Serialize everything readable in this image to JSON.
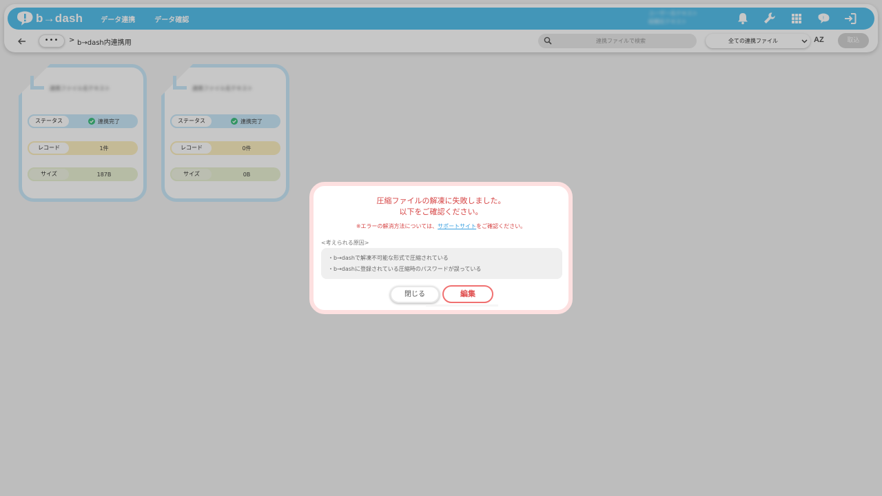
{
  "brand": {
    "name": "b→dash",
    "accent_color": "#56c0ec"
  },
  "nav": {
    "links": [
      "データ連携",
      "データ確認"
    ],
    "user_info_blurred": [
      "ユーザー名テキスト",
      "組織名テキスト"
    ],
    "icons": [
      "bell-icon",
      "wrench-icon",
      "apps-grid-icon",
      "help-chat-icon",
      "logout-icon"
    ]
  },
  "subbar": {
    "dots": "•••",
    "breadcrumb_sep": ">",
    "breadcrumb_current": "b→dash内連携用",
    "search_placeholder": "連携ファイルで検索",
    "filter_selected": "全ての連携ファイル",
    "sort_label": "AZ",
    "fetch_label": "取込"
  },
  "cards": [
    {
      "title_blurred": "連携ファイル名テキスト",
      "status_label": "ステータス",
      "status_value": "連携完了",
      "record_label": "レコード",
      "record_value": "1件",
      "size_label": "サイズ",
      "size_value": "187B"
    },
    {
      "title_blurred": "連携ファイル名テキスト",
      "status_label": "ステータス",
      "status_value": "連携完了",
      "record_label": "レコード",
      "record_value": "0件",
      "size_label": "サイズ",
      "size_value": "0B"
    }
  ],
  "modal": {
    "title_line1": "圧縮ファイルの解凍に失敗しました。",
    "title_line2": "以下をご確認ください。",
    "note_prefix": "※エラーの解消方法については、",
    "note_link": "サポートサイト",
    "note_suffix": "をご確認ください。",
    "causes_heading": "<考えられる原因>",
    "causes": [
      "・b→dashで解凍不可能な形式で圧縮されている",
      "・b→dashに登録されている圧縮時のパスワードが誤っている"
    ],
    "close_label": "閉じる",
    "edit_label": "編集",
    "error_color": "#d64545"
  }
}
